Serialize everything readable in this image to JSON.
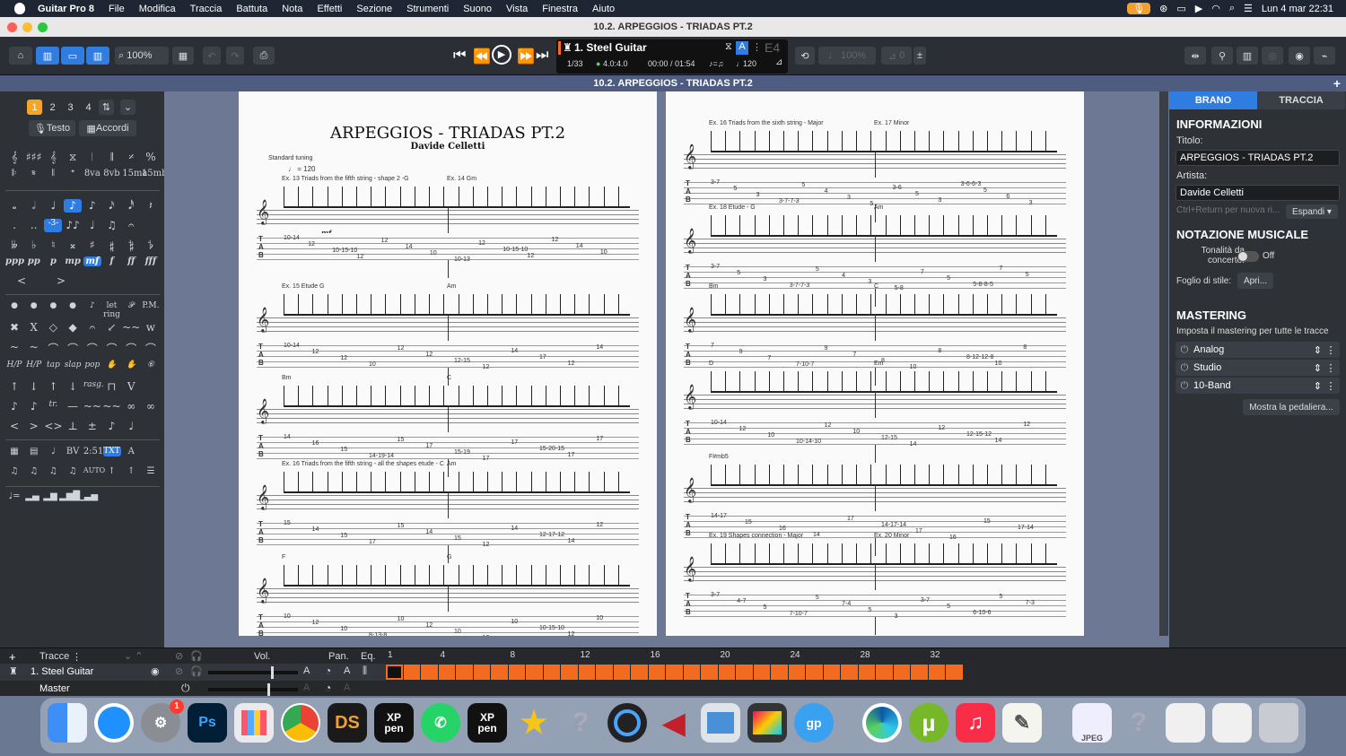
{
  "menubar": {
    "app": "Guitar Pro 8",
    "items": [
      "File",
      "Modifica",
      "Traccia",
      "Battuta",
      "Nota",
      "Effetti",
      "Sezione",
      "Strumenti",
      "Suono",
      "Vista",
      "Finestra",
      "Aiuto"
    ],
    "clock": "Lun 4 mar  22:31"
  },
  "window": {
    "title": "10.2. ARPEGGIOS - TRIADAS PT.2"
  },
  "toolbar": {
    "zoom": "100%",
    "track_name": "1. Steel Guitar",
    "position": "1/33",
    "time_sig": "4.0:4.0",
    "time": "00:00 / 01:54",
    "tempo": "120",
    "key": "E4",
    "speed": "100%",
    "metronome_count": "0"
  },
  "docbar": {
    "title": "10.2. ARPEGGIOS - TRIADAS PT.2"
  },
  "palette": {
    "voices": [
      "1",
      "2",
      "3",
      "4"
    ],
    "testo_label": "Testo",
    "accordi_label": "Accordi",
    "bar_row": [
      "𝄞",
      "♯♯♯",
      "𝄞",
      "⧖",
      "𝄀",
      "𝄂",
      "𝄎",
      "%"
    ],
    "bar_row2": [
      "𝄆",
      "𝄋",
      "𝄃",
      "𝄌",
      "8va",
      "8vb",
      "15ma",
      "15mb"
    ],
    "durations": [
      "𝅝",
      "𝅗𝅥",
      "♩",
      "♪",
      "♪",
      "𝅘𝅥𝅯",
      "𝅘𝅥𝅰",
      "𝄽"
    ],
    "dots": [
      ".",
      "..",
      "-3-",
      "♪♪",
      "♩",
      "♫",
      "𝄐"
    ],
    "accidentals": [
      "𝄫",
      "♭",
      "♮",
      "𝄪",
      "♯",
      "𝄱",
      "𝄲",
      "𝄳"
    ],
    "dynamics": [
      "ppp",
      "pp",
      "p",
      "mp",
      "mf",
      "f",
      "ff",
      "fff"
    ],
    "hairpins": [
      "<",
      ">"
    ],
    "effects1": [
      "●",
      "●",
      "●",
      "●",
      "♪",
      "let ring",
      "𝒫",
      "P.M."
    ],
    "effects2": [
      "✖",
      "X",
      "◇",
      "◆",
      "𝄐",
      "↙",
      "~~",
      "w"
    ],
    "effects3": [
      "~",
      "~",
      "⌒",
      "⌒",
      "⌒",
      "⌒",
      "⌒",
      "⌒"
    ],
    "effects4": [
      "H/P",
      "H/P",
      "tap",
      "slap",
      "pop",
      "✋",
      "✋",
      "⑥"
    ],
    "effects5": [
      "↑",
      "↓",
      "↑",
      "↓",
      "rasg.",
      "⊓",
      "V"
    ],
    "effects6": [
      "♪",
      "♪",
      "tr.",
      "—",
      "~~",
      "~~",
      "∞",
      "∞"
    ],
    "effects7": [
      "<",
      ">",
      "<>",
      "⊥",
      "±",
      "♪",
      "♩"
    ],
    "misc1": [
      "▦",
      "▤",
      "♩",
      "BV",
      "2:51",
      "TXT",
      "A"
    ],
    "misc2": [
      "♫",
      "♫",
      "♫",
      "♫",
      "AUTO",
      "↑",
      "↑",
      "☰"
    ],
    "misc3": [
      "♩=",
      "▂▄",
      "▂▆",
      "▂▆█",
      "▁▃▅"
    ]
  },
  "score_left": {
    "title": "ARPEGGIOS - TRIADAS PT.2",
    "composer": "Davide Celletti",
    "tuning": "Standard tuning",
    "tempo_mark": "♩ = 120",
    "dynamic": "mf",
    "systems": [
      {
        "labels": [
          "Ex. 13  Triads from the fifth string - shape 2 -G",
          "Ex. 14  Gm"
        ],
        "tab": [
          "10-14",
          "12",
          "10-15-10",
          "12",
          "12",
          "14",
          "10",
          "10-13",
          "12",
          "10-15-10",
          "12",
          "12",
          "14",
          "10"
        ]
      },
      {
        "labels": [
          "Ex. 15 Etude  G",
          "Am"
        ],
        "tab": [
          "10-14",
          "12",
          "12",
          "10",
          "12",
          "12",
          "12-15",
          "12",
          "14",
          "17",
          "12",
          "14"
        ]
      },
      {
        "labels": [
          "Bm",
          "C"
        ],
        "tab": [
          "14",
          "16",
          "15",
          "14-19-14",
          "15",
          "17",
          "15-19",
          "17",
          "17",
          "15-20-15",
          "17",
          "17"
        ]
      },
      {
        "labels": [
          "Ex. 16 Triads from the fifth string - all the shapes etude - C",
          "Am"
        ],
        "tab": [
          "15",
          "14",
          "15",
          "17",
          "15",
          "14",
          "15",
          "12",
          "14",
          "12-17-12",
          "14",
          "12"
        ]
      },
      {
        "labels": [
          "F",
          "G"
        ],
        "tab": [
          "10",
          "12",
          "10",
          "8-13-8",
          "10",
          "12",
          "10",
          "12",
          "10",
          "10-15-10",
          "12",
          "10"
        ]
      }
    ]
  },
  "score_right": {
    "systems": [
      {
        "labels": [
          "Ex. 16 Triads from the sixth string - Major",
          "Ex. 17 Minor"
        ],
        "tab": [
          "3-7",
          "5",
          "3",
          "3-7-7-3",
          "5",
          "4",
          "3",
          "5",
          "3-6",
          "5",
          "3",
          "3-6-6-3",
          "5",
          "6",
          "3"
        ]
      },
      {
        "labels": [
          "Ex. 18 Etude - G",
          "Am"
        ],
        "tab": [
          "3-7",
          "5",
          "3",
          "3-7-7-3",
          "5",
          "4",
          "3",
          "5-8",
          "7",
          "5",
          "5-8-8-5",
          "7",
          "5"
        ]
      },
      {
        "labels": [
          "Bm",
          "C"
        ],
        "tab": [
          "7",
          "9",
          "7",
          "7-10-7",
          "9",
          "7",
          "8",
          "10",
          "8",
          "8-12-12-8",
          "10",
          "8"
        ]
      },
      {
        "labels": [
          "D",
          "Em"
        ],
        "tab": [
          "10-14",
          "12",
          "10",
          "10-14-10",
          "12",
          "10",
          "12-15",
          "14",
          "12",
          "12-15-12",
          "14",
          "12"
        ]
      },
      {
        "labels": [
          "F#mb5"
        ],
        "tab": [
          "14-17",
          "15",
          "16",
          "14",
          "17",
          "14-17-14",
          "17",
          "16",
          "15",
          "17-14"
        ]
      },
      {
        "labels": [
          "Ex. 19 Shapes connection - Major",
          "Ex. 20 Minor"
        ],
        "tab": [
          "3-7",
          "4-7",
          "5",
          "7-10-7",
          "5",
          "7-4",
          "5",
          "3",
          "3-7",
          "5",
          "6-10-6",
          "5",
          "7-3"
        ]
      }
    ]
  },
  "right_panel": {
    "tab_song": "BRANO",
    "tab_track": "TRACCIA",
    "info_title": "INFORMAZIONI",
    "title_label": "Titolo:",
    "title_value": "ARPEGGIOS - TRIADAS PT.2",
    "artist_label": "Artista:",
    "artist_value": "Davide Celletti",
    "new_line_hint": "Ctrl+Return per nuova ri...",
    "expand_label": "Espandi",
    "notation_title": "NOTAZIONE MUSICALE",
    "concert_label": "Tonalità da concerto:",
    "concert_state": "Off",
    "style_label": "Foglio di stile:",
    "style_button": "Apri...",
    "mastering_title": "MASTERING",
    "mastering_sub": "Imposta il mastering per tutte le tracce",
    "mastering_items": [
      "Analog",
      "Studio",
      "10-Band"
    ],
    "pedalboard_button": "Mostra la pedaliera..."
  },
  "tracks": {
    "header": "Tracce",
    "vol": "Vol.",
    "pan": "Pan.",
    "eq": "Eq.",
    "ruler": [
      "1",
      "4",
      "8",
      "12",
      "16",
      "20",
      "24",
      "28",
      "32"
    ],
    "track1": "1. Steel Guitar",
    "master": "Master",
    "bars_total": 33,
    "accent": "#f26b21"
  },
  "dock": {
    "apps": [
      "finder",
      "safari",
      "settings",
      "photoshop",
      "launchpad",
      "chrome",
      "daz-studio",
      "xp-pen",
      "whatsapp",
      "xp-pen-2",
      "imovie-star",
      "help",
      "quicktime",
      "affinity",
      "preview",
      "final-cut",
      "guitar-pro",
      "edge",
      "utorrent",
      "music",
      "textedit",
      "jpeg",
      "help-2",
      "chrome-doc",
      "chrome-doc-2",
      "trash"
    ],
    "labels": {
      "ps": "Ps",
      "ds": "DS",
      "xp": "XP\npen",
      "gp": "gp",
      "jpeg": "JPEG"
    },
    "badge": "1"
  }
}
